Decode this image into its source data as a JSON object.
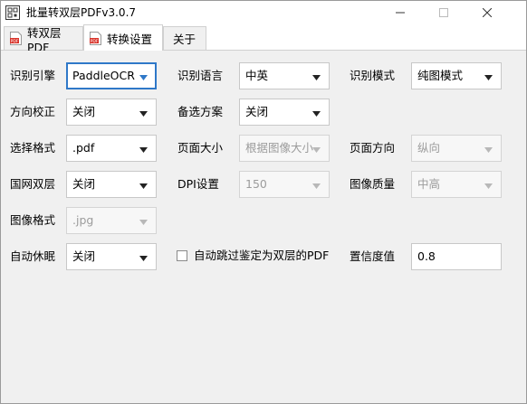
{
  "window": {
    "title": "批量转双层PDFv3.0.7"
  },
  "tabs": [
    {
      "label": "转双层PDF",
      "icon": "pdf-icon"
    },
    {
      "label": "转换设置",
      "icon": "pdf-icon"
    },
    {
      "label": "关于"
    }
  ],
  "settings": {
    "ocr_engine": {
      "label": "识别引擎",
      "value": "PaddleOCR"
    },
    "ocr_language": {
      "label": "识别语言",
      "value": "中英"
    },
    "ocr_mode": {
      "label": "识别模式",
      "value": "纯图模式"
    },
    "orientation": {
      "label": "方向校正",
      "value": "关闭"
    },
    "fallback": {
      "label": "备选方案",
      "value": "关闭"
    },
    "select_format": {
      "label": "选择格式",
      "value": ".pdf"
    },
    "page_size": {
      "label": "页面大小",
      "value": "根据图像大小"
    },
    "page_orientation": {
      "label": "页面方向",
      "value": "纵向"
    },
    "gov_dual_layer": {
      "label": "国网双层",
      "value": "关闭"
    },
    "dpi": {
      "label": "DPI设置",
      "value": "150"
    },
    "image_quality": {
      "label": "图像质量",
      "value": "中高"
    },
    "image_format": {
      "label": "图像格式",
      "value": ".jpg"
    },
    "auto_sleep": {
      "label": "自动休眠",
      "value": "关闭"
    },
    "skip_dual_layer": {
      "label": "自动跳过鉴定为双层的PDF",
      "checked": false
    },
    "confidence": {
      "label": "置信度值",
      "value": "0.8"
    }
  },
  "colors": {
    "focus_border": "#2f78c8",
    "panel_bg": "#f0f0f0",
    "disabled_text": "#9c9c9c"
  }
}
